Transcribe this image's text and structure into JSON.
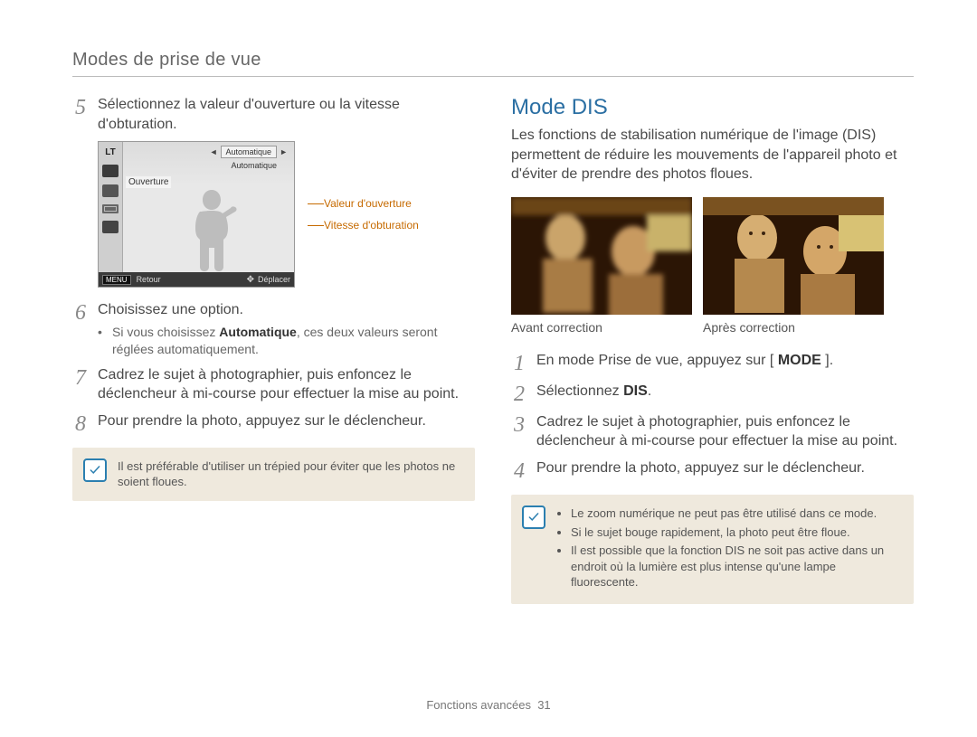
{
  "header": "Modes de prise de vue",
  "footer": {
    "section": "Fonctions avancées",
    "page": "31"
  },
  "left": {
    "steps": {
      "s5": {
        "num": "5",
        "text": "Sélectionnez la valeur d'ouverture ou la vitesse d'obturation."
      },
      "s6": {
        "num": "6",
        "text": "Choisissez une option.",
        "sub_prefix": "Si vous choisissez ",
        "sub_bold": "Automatique",
        "sub_suffix": ", ces deux valeurs seront réglées automatiquement."
      },
      "s7": {
        "num": "7",
        "text": "Cadrez le sujet à photographier, puis enfoncez le déclencheur à mi-course pour effectuer la mise au point."
      },
      "s8": {
        "num": "8",
        "text": "Pour prendre la photo, appuyez sur le déclencheur."
      }
    },
    "camera": {
      "lt": "LT",
      "auto1": "Automatique",
      "auto2": "Automatique",
      "row_label": "Ouverture",
      "menu": "MENU",
      "retour": "Retour",
      "deplacer": "Déplacer"
    },
    "callouts": {
      "aperture": "Valeur d'ouverture",
      "shutter": "Vitesse d'obturation"
    },
    "note": "Il est préférable d'utiliser un trépied pour éviter que les photos ne soient floues."
  },
  "right": {
    "title": "Mode DIS",
    "intro": "Les fonctions de stabilisation numérique de l'image (DIS) permettent de réduire les mouvements de l'appareil photo et d'éviter de prendre des photos floues.",
    "captions": {
      "before": "Avant correction",
      "after": "Après correction"
    },
    "steps": {
      "s1": {
        "num": "1",
        "prefix": "En mode Prise de vue, appuyez sur [ ",
        "bold": "MODE",
        "suffix": " ]."
      },
      "s2": {
        "num": "2",
        "prefix": "Sélectionnez ",
        "bold": "DIS",
        "suffix": "."
      },
      "s3": {
        "num": "3",
        "text": "Cadrez le sujet à photographier, puis enfoncez le déclencheur à mi-course pour effectuer la mise au point."
      },
      "s4": {
        "num": "4",
        "text": "Pour prendre la photo, appuyez sur le déclencheur."
      }
    },
    "note": {
      "i1": "Le zoom numérique ne peut pas être utilisé dans ce mode.",
      "i2": "Si le sujet bouge rapidement, la photo peut être floue.",
      "i3": "Il est possible que la fonction DIS ne soit pas active dans un endroit où la lumière est plus intense qu'une lampe fluorescente."
    }
  }
}
